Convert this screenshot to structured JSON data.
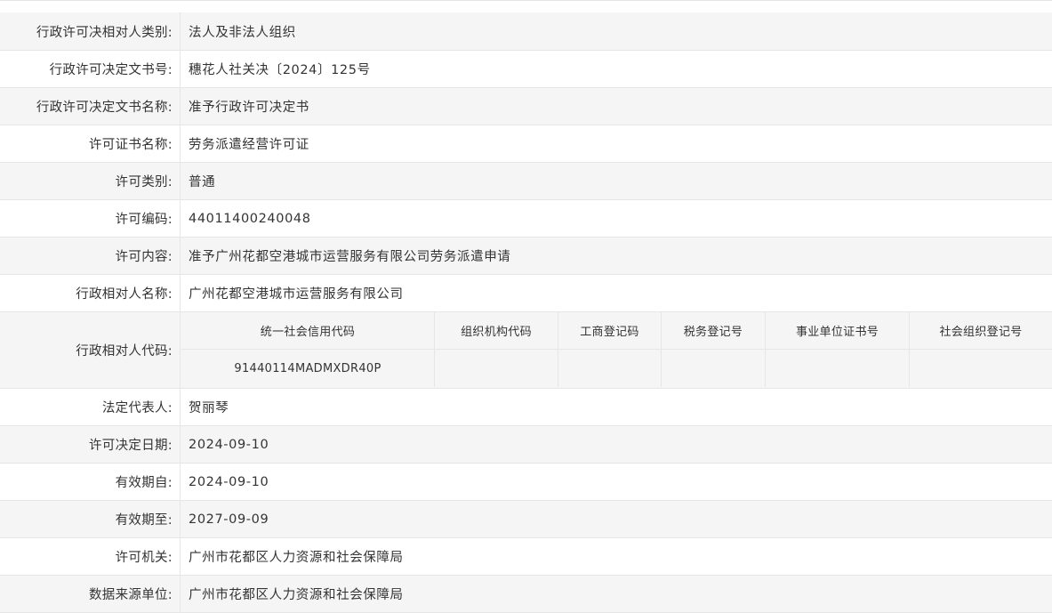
{
  "records": {
    "rows": [
      {
        "label": "行政许可决相对人类别:",
        "value": "法人及非法人组织"
      },
      {
        "label": "行政许可决定文书号:",
        "value": "穗花人社关决〔2024〕125号"
      },
      {
        "label": "行政许可决定文书名称:",
        "value": "准予行政许可决定书"
      },
      {
        "label": "许可证书名称:",
        "value": "劳务派遣经营许可证"
      },
      {
        "label": "许可类别:",
        "value": "普通"
      },
      {
        "label": "许可编码:",
        "value": "44011400240048"
      },
      {
        "label": "许可内容:",
        "value": "准予广州花都空港城市运营服务有限公司劳务派遣申请"
      },
      {
        "label": "行政相对人名称:",
        "value": "广州花都空港城市运营服务有限公司"
      },
      {
        "label": "行政相对人代码:",
        "value": ""
      },
      {
        "label": "法定代表人:",
        "value": "贺丽琴"
      },
      {
        "label": "许可决定日期:",
        "value": "2024-09-10"
      },
      {
        "label": "有效期自:",
        "value": "2024-09-10"
      },
      {
        "label": "有效期至:",
        "value": "2027-09-09"
      },
      {
        "label": "许可机关:",
        "value": "广州市花都区人力资源和社会保障局"
      },
      {
        "label": "数据来源单位:",
        "value": "广州市花都区人力资源和社会保障局"
      }
    ]
  },
  "codes": {
    "headers": [
      "统一社会信用代码",
      "组织机构代码",
      "工商登记码",
      "税务登记号",
      "事业单位证书号",
      "社会组织登记号"
    ],
    "values": [
      "91440114MADMXDR40P",
      "",
      "",
      "",
      "",
      ""
    ]
  },
  "colors": {
    "row_alt": "#f5f5f5",
    "row_plain": "#ffffff",
    "border": "#e6e6e6",
    "text": "#333333"
  }
}
